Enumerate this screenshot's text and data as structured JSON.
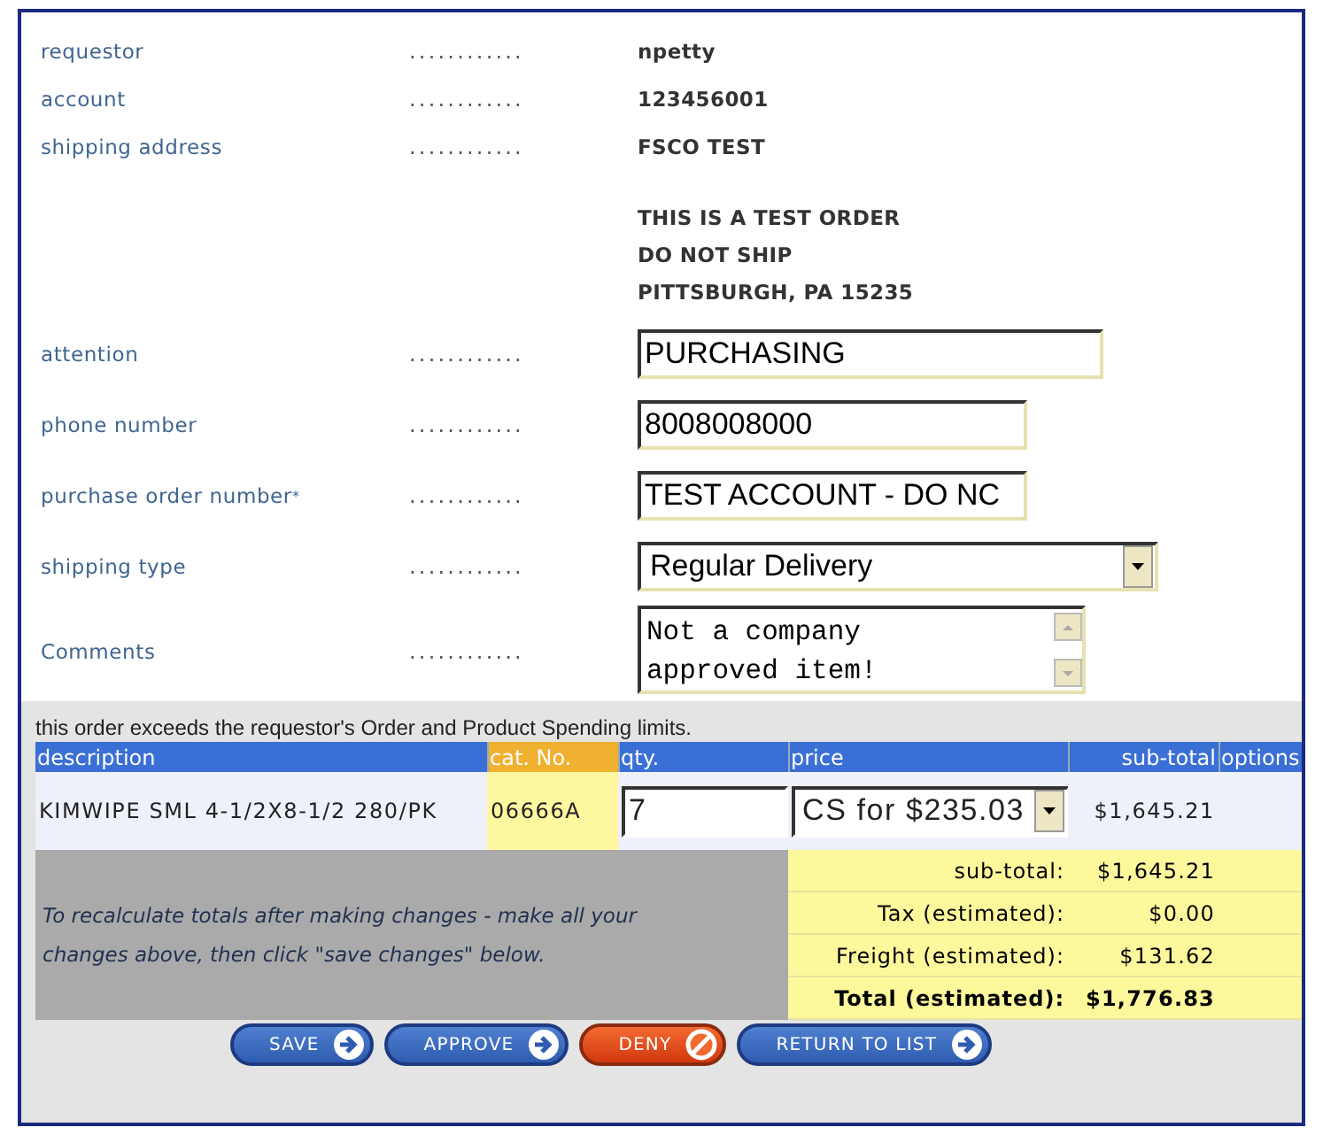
{
  "fields": [
    {
      "kind": "static",
      "label": "requestor",
      "value": "npetty"
    },
    {
      "kind": "static",
      "label": "account",
      "value": "123456001"
    },
    {
      "kind": "static",
      "label": "shipping address",
      "value": "FSCO TEST"
    },
    {
      "kind": "address",
      "lines": [
        "THIS IS A TEST ORDER",
        "DO NOT SHIP",
        "PITTSBURGH, PA 15235"
      ]
    },
    {
      "kind": "input",
      "label": "attention",
      "value": "PURCHASING"
    },
    {
      "kind": "input",
      "label": "phone number",
      "value": "8008008000"
    },
    {
      "kind": "input",
      "label": "purchase order number$^{*}$",
      "value": "TEST ACCOUNT - DO NC"
    },
    {
      "kind": "select",
      "label": "shipping type",
      "value": "Regular Delivery"
    },
    {
      "kind": "textarea",
      "label": "Comments",
      "value": "Not a company\napproved item!"
    }
  ],
  "leader": "............",
  "notice": "this order exceeds the requestor's Order and Product Spending limits.",
  "table": {
    "columns": [
      {
        "label": "description",
        "highlight": false
      },
      {
        "label": "cat. No.",
        "highlight": true
      },
      {
        "label": "qty.",
        "highlight": false
      },
      {
        "label": "price",
        "highlight": false
      },
      {
        "label": "sub-total",
        "highlight": false
      },
      {
        "label": "options",
        "highlight": false
      }
    ],
    "rows": [
      {
        "description": "KIMWIPE SML 4-1/2X8-1/2 280/PK",
        "cat_no": "06666A",
        "qty": "7",
        "price": "CS for $235.03",
        "subtotal": "$1,645.21"
      }
    ],
    "note": "To recalculate totals after making changes - make all your changes above, then click \"save changes\" below.",
    "totals": [
      {
        "label": "sub-total:",
        "value": "$1,645.21",
        "bold": false
      },
      {
        "label": "Tax (estimated):",
        "value": "$0.00",
        "bold": false
      },
      {
        "label": "Freight (estimated):",
        "value": "$131.62",
        "bold": false
      },
      {
        "label": "Total (estimated):",
        "value": "$1,776.83",
        "bold": true
      }
    ]
  },
  "buttons": [
    {
      "label": "SAVE",
      "kind": "go"
    },
    {
      "label": "APPROVE",
      "kind": "go"
    },
    {
      "label": "DENY",
      "kind": "deny"
    },
    {
      "label": "RETURN TO LIST",
      "kind": "go"
    }
  ]
}
